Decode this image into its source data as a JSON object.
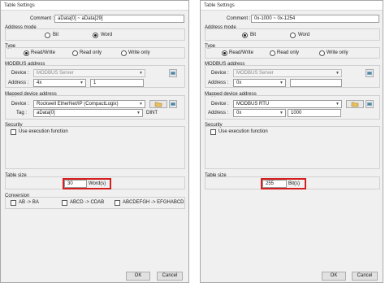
{
  "left": {
    "title": "Table Settings",
    "comment_label": "Comment :",
    "comment_value": "aData[0] ~ aData[29]",
    "address_mode_label": "Address mode",
    "mode_bit": "Bit",
    "mode_word": "Word",
    "mode_selected": "Word",
    "type_label": "Type",
    "type_readwrite": "Read/Write",
    "type_readonly": "Read only",
    "type_writeonly": "Write only",
    "modbus_label": "MODBUS address",
    "device_label": "Device :",
    "device_value": "MODBUS Server",
    "address_label": "Address :",
    "address_type": "4x",
    "address_value": "1",
    "mapped_label": "Mapped device address",
    "mapped_device_label": "Device :",
    "mapped_device_value": "Rockwell EtherNet/IP (CompactLogix)",
    "tag_label": "Tag :",
    "tag_value": "aData[0]",
    "tag_type": "DINT",
    "security_label": "Security",
    "use_exec": "Use execution function",
    "table_size_label": "Table size",
    "table_size_value": "30",
    "table_size_unit": "Word(s)",
    "conversion_label": "Conversion",
    "conv_1": "AB -> BA",
    "conv_2": "ABCD -> CDAB",
    "conv_3": "ABCDEFGH -> EFGHABCD",
    "ok": "OK",
    "cancel": "Cancel"
  },
  "right": {
    "title": "Table Settings",
    "comment_label": "Comment :",
    "comment_value": "0x-1000 ~ 0x-1254",
    "address_mode_label": "Address mode",
    "mode_bit": "Bit",
    "mode_word": "Word",
    "mode_selected": "Bit",
    "type_label": "Type",
    "type_readwrite": "Read/Write",
    "type_readonly": "Read only",
    "type_writeonly": "Write only",
    "modbus_label": "MODBUS address",
    "device_label": "Device :",
    "device_value": "MODBUS Server",
    "address_label": "Address :",
    "address_type": "0x",
    "address_value": "",
    "mapped_label": "Mapped device address",
    "mapped_device_label": "Device :",
    "mapped_device_value": "MODBUS RTU",
    "mapped_address_label": "Address :",
    "mapped_address_type": "0x",
    "mapped_address_value": "1000",
    "security_label": "Security",
    "use_exec": "Use execution function",
    "table_size_label": "Table size",
    "table_size_value": "255",
    "table_size_unit": "Bit(s)",
    "ok": "OK",
    "cancel": "Cancel"
  },
  "colors": {
    "highlight": "#d42020",
    "dialog_bg": "#f0f0f0"
  }
}
